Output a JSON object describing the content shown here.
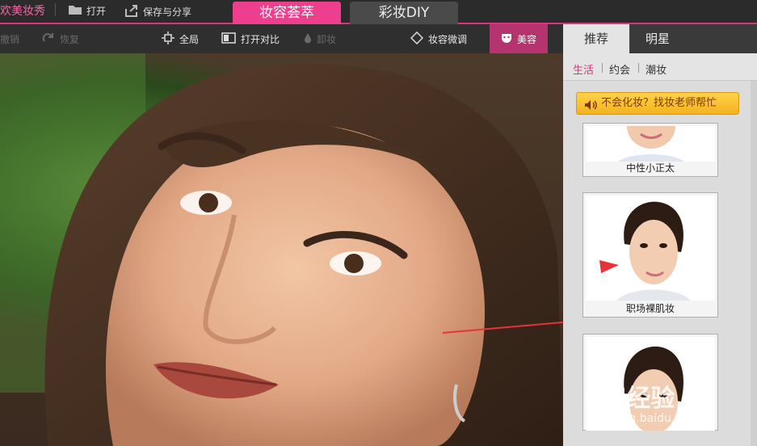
{
  "app": {
    "brand": "欢美妆秀"
  },
  "topbar": {
    "open_label": "打开",
    "save_share_label": "保存与分享",
    "tabs": [
      "妆容荟萃",
      "彩妆DIY"
    ]
  },
  "toolbar": {
    "undo_label": "撤销",
    "redo_label": "恢复",
    "fit_label": "全局",
    "compare_label": "打开对比",
    "remove_label": "卸妆",
    "finetune_label": "妆容微调",
    "beauty_label": "美容"
  },
  "panel": {
    "tabs": [
      "推荐",
      "明星"
    ],
    "subtabs": [
      "生活",
      "约会",
      "潮妆"
    ],
    "help_label": "不会化妆？找妆老师帮忙",
    "cards": [
      {
        "caption": "中性小正太"
      },
      {
        "caption": "职场裸肌妆"
      },
      {
        "caption": ""
      }
    ]
  },
  "watermark": {
    "brand": "Bai经验",
    "url": "jingyan.baidu.com"
  },
  "colors": {
    "accent": "#e0317e",
    "tab_active": "#ee3e8e",
    "arrow": "#e8323a"
  }
}
